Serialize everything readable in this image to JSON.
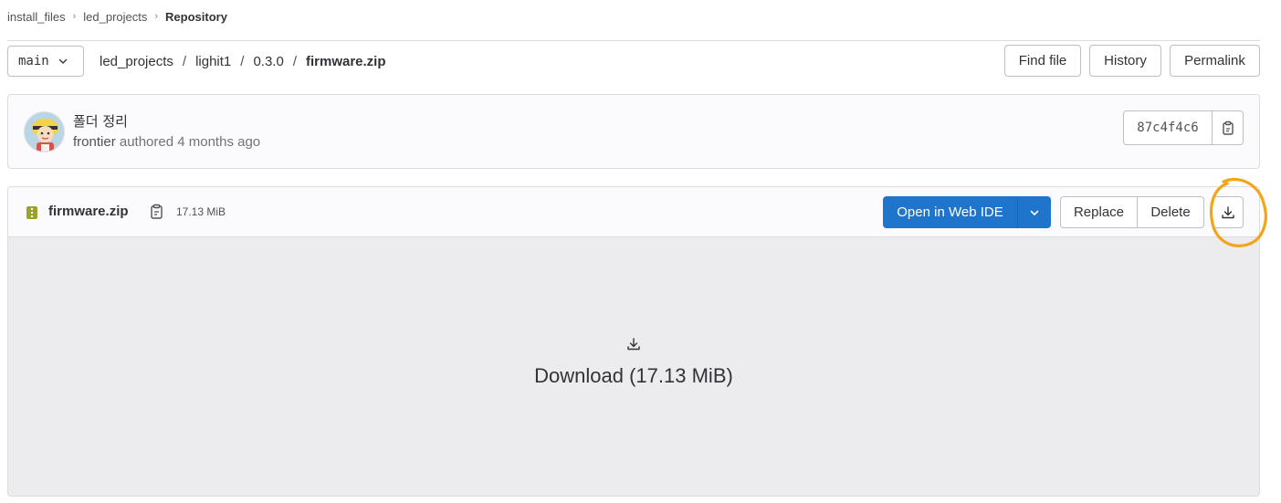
{
  "breadcrumb": {
    "items": [
      "install_files",
      "led_projects",
      "Repository"
    ]
  },
  "nav": {
    "branch": "main",
    "path": [
      "led_projects",
      "lighit1",
      "0.3.0",
      "firmware.zip"
    ],
    "find_file": "Find file",
    "history": "History",
    "permalink": "Permalink"
  },
  "commit": {
    "title": "폴더 정리",
    "author": "frontier",
    "authored_text": "authored 4 months ago",
    "sha": "87c4f4c6"
  },
  "file": {
    "name": "firmware.zip",
    "size": "17.13 MiB",
    "open_ide": "Open in Web IDE",
    "replace": "Replace",
    "delete": "Delete",
    "download_text": "Download (17.13 MiB)"
  },
  "colors": {
    "primary": "#1f75cb",
    "highlight": "#f5a418",
    "body_bg": "#ececef"
  },
  "icons": [
    "chevron-down-icon",
    "copy-icon",
    "zip-file-icon",
    "download-icon",
    "avatar"
  ]
}
